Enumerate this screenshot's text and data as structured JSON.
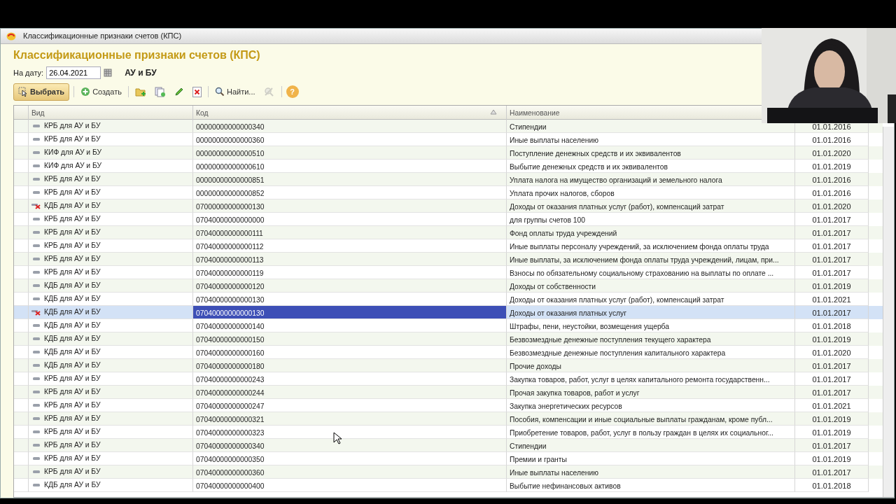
{
  "window": {
    "title": "Классификационные признаки счетов (КПС)"
  },
  "form": {
    "heading": "Классификационные признаки счетов (КПС)",
    "date_label": "На дату:",
    "date_value": "26.04.2021",
    "ledger": "АУ и БУ"
  },
  "toolbar": [
    {
      "kind": "select",
      "label": "Выбрать"
    },
    {
      "kind": "create",
      "label": "Создать"
    },
    {
      "kind": "add-folder"
    },
    {
      "kind": "copy"
    },
    {
      "kind": "edit"
    },
    {
      "kind": "delete"
    },
    {
      "kind": "find",
      "label": "Найти..."
    },
    {
      "kind": "cancel-find",
      "disabled": true
    },
    {
      "kind": "help",
      "label": "?"
    }
  ],
  "table": {
    "columns": [
      "Вид",
      "Код",
      "Наименование"
    ],
    "rows": [
      {
        "deleted": false,
        "selected": false,
        "cells": [
          "КРБ для АУ и БУ",
          "00000000000000340",
          "Стипендии",
          "01.01.2016"
        ]
      },
      {
        "deleted": false,
        "selected": false,
        "cells": [
          "КРБ для АУ и БУ",
          "00000000000000360",
          "Иные выплаты населению",
          "01.01.2016"
        ]
      },
      {
        "deleted": false,
        "selected": false,
        "cells": [
          "КИФ для АУ и БУ",
          "00000000000000510",
          "Поступление денежных средств и их эквивалентов",
          "01.01.2020"
        ]
      },
      {
        "deleted": false,
        "selected": false,
        "cells": [
          "КИФ для АУ и БУ",
          "00000000000000610",
          "Выбытие денежных средств и их эквивалентов",
          "01.01.2019"
        ]
      },
      {
        "deleted": false,
        "selected": false,
        "cells": [
          "КРБ для АУ и БУ",
          "00000000000000851",
          "Уплата налога на имущество организаций и земельного налога",
          "01.01.2016"
        ]
      },
      {
        "deleted": false,
        "selected": false,
        "cells": [
          "КРБ для АУ и БУ",
          "00000000000000852",
          "Уплата прочих налогов, сборов",
          "01.01.2016"
        ]
      },
      {
        "deleted": true,
        "selected": false,
        "cells": [
          "КДБ для АУ и БУ",
          "07000000000000130",
          "Доходы от оказания платных услуг (работ), компенсаций затрат",
          "01.01.2020"
        ]
      },
      {
        "deleted": false,
        "selected": false,
        "cells": [
          "КРБ для АУ и БУ",
          "07040000000000000",
          "для группы счетов 100",
          "01.01.2017"
        ]
      },
      {
        "deleted": false,
        "selected": false,
        "cells": [
          "КРБ для АУ и БУ",
          "07040000000000111",
          "Фонд оплаты труда учреждений",
          "01.01.2017"
        ]
      },
      {
        "deleted": false,
        "selected": false,
        "cells": [
          "КРБ для АУ и БУ",
          "07040000000000112",
          "Иные выплаты персоналу учреждений, за исключением фонда оплаты труда",
          "01.01.2017"
        ]
      },
      {
        "deleted": false,
        "selected": false,
        "cells": [
          "КРБ для АУ и БУ",
          "07040000000000113",
          "Иные выплаты, за исключением фонда оплаты труда учреждений, лицам, при...",
          "01.01.2017"
        ]
      },
      {
        "deleted": false,
        "selected": false,
        "cells": [
          "КРБ для АУ и БУ",
          "07040000000000119",
          "Взносы по обязательному социальному страхованию на выплаты по оплате ...",
          "01.01.2017"
        ]
      },
      {
        "deleted": false,
        "selected": false,
        "cells": [
          "КДБ для АУ и БУ",
          "07040000000000120",
          "Доходы от собственности",
          "01.01.2019"
        ]
      },
      {
        "deleted": false,
        "selected": false,
        "cells": [
          "КДБ для АУ и БУ",
          "07040000000000130",
          "Доходы от оказания платных услуг (работ), компенсаций затрат",
          "01.01.2021"
        ]
      },
      {
        "deleted": true,
        "selected": true,
        "cells": [
          "КДБ для АУ и БУ",
          "07040000000000130",
          "Доходы от оказания платных услуг",
          "01.01.2017"
        ]
      },
      {
        "deleted": false,
        "selected": false,
        "cells": [
          "КДБ для АУ и БУ",
          "07040000000000140",
          "Штрафы, пени, неустойки, возмещения ущерба",
          "01.01.2018"
        ]
      },
      {
        "deleted": false,
        "selected": false,
        "cells": [
          "КДБ для АУ и БУ",
          "07040000000000150",
          "Безвозмездные денежные поступления текущего характера",
          "01.01.2019"
        ]
      },
      {
        "deleted": false,
        "selected": false,
        "cells": [
          "КДБ для АУ и БУ",
          "07040000000000160",
          "Безвозмездные денежные поступления капитального характера",
          "01.01.2020"
        ]
      },
      {
        "deleted": false,
        "selected": false,
        "cells": [
          "КДБ для АУ и БУ",
          "07040000000000180",
          "Прочие доходы",
          "01.01.2017"
        ]
      },
      {
        "deleted": false,
        "selected": false,
        "cells": [
          "КРБ для АУ и БУ",
          "07040000000000243",
          "Закупка товаров, работ, услуг в целях капитального ремонта государственн...",
          "01.01.2017"
        ]
      },
      {
        "deleted": false,
        "selected": false,
        "cells": [
          "КРБ для АУ и БУ",
          "07040000000000244",
          "Прочая закупка товаров, работ и услуг",
          "01.01.2017"
        ]
      },
      {
        "deleted": false,
        "selected": false,
        "cells": [
          "КРБ для АУ и БУ",
          "07040000000000247",
          "Закупка энергетических ресурсов",
          "01.01.2021"
        ]
      },
      {
        "deleted": false,
        "selected": false,
        "cells": [
          "КРБ для АУ и БУ",
          "07040000000000321",
          "Пособия, компенсации и иные социальные выплаты гражданам, кроме публ...",
          "01.01.2019"
        ]
      },
      {
        "deleted": false,
        "selected": false,
        "cells": [
          "КРБ для АУ и БУ",
          "07040000000000323",
          "Приобретение товаров, работ, услуг в пользу граждан в целях их социальног...",
          "01.01.2019"
        ]
      },
      {
        "deleted": false,
        "selected": false,
        "cells": [
          "КРБ для АУ и БУ",
          "07040000000000340",
          "Стипендии",
          "01.01.2017"
        ]
      },
      {
        "deleted": false,
        "selected": false,
        "cells": [
          "КРБ для АУ и БУ",
          "07040000000000350",
          "Премии и гранты",
          "01.01.2019"
        ]
      },
      {
        "deleted": false,
        "selected": false,
        "cells": [
          "КРБ для АУ и БУ",
          "07040000000000360",
          "Иные выплаты населению",
          "01.01.2017"
        ]
      },
      {
        "deleted": false,
        "selected": false,
        "cells": [
          "КДБ для АУ и БУ",
          "07040000000000400",
          "Выбытие нефинансовых активов",
          "01.01.2018"
        ]
      }
    ]
  }
}
